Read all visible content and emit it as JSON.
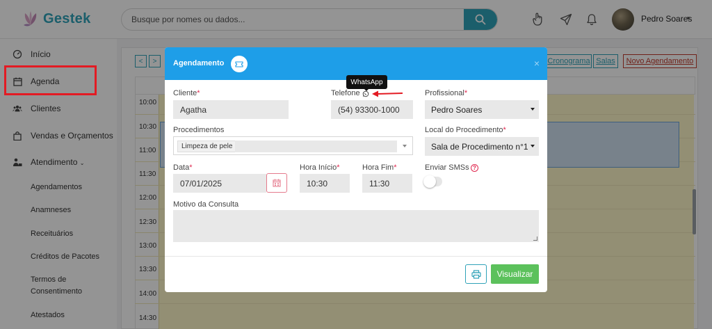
{
  "app": {
    "name": "Gestek",
    "accent": "#2fa2b8"
  },
  "search": {
    "placeholder": "Busque por nomes ou dados..."
  },
  "user": {
    "name": "Pedro Soares"
  },
  "sidebar": {
    "items": [
      {
        "label": "Início",
        "icon": "home-icon"
      },
      {
        "label": "Agenda",
        "icon": "calendar-icon"
      },
      {
        "label": "Clientes",
        "icon": "users-icon"
      },
      {
        "label": "Vendas e Orçamentos",
        "icon": "shopping-bag-icon"
      },
      {
        "label": "Atendimento",
        "icon": "stethoscope-icon",
        "expanded": true
      }
    ],
    "subitems": [
      "Agendamentos",
      "Anamneses",
      "Receituários",
      "Créditos de Pacotes",
      "Termos de Consentimento",
      "Atestados"
    ]
  },
  "calendar": {
    "nav_prev": "<",
    "nav_next": ">",
    "buttons": {
      "cronograma": "Cronograma",
      "salas": "Salas",
      "novo": "Novo Agendamento"
    },
    "times": [
      "10:00",
      "10:30",
      "11:00",
      "11:30",
      "12:00",
      "12:30",
      "13:00",
      "13:30",
      "14:00",
      "14:30"
    ]
  },
  "modal": {
    "title": "Agendamento",
    "tooltip": "WhatsApp",
    "fields": {
      "cliente": {
        "label": "Cliente",
        "value": "Agatha"
      },
      "telefone": {
        "label": "Telefone",
        "value": "(54) 93300-1000"
      },
      "profissional": {
        "label": "Profissional",
        "value": "Pedro Soares"
      },
      "procedimentos": {
        "label": "Procedimentos",
        "tag": "Limpeza de pele"
      },
      "local": {
        "label": "Local do Procedimento",
        "value": "Sala de Procedimento n°1"
      },
      "data": {
        "label": "Data",
        "value": "07/01/2025"
      },
      "hora_inicio": {
        "label": "Hora Início",
        "value": "10:30"
      },
      "hora_fim": {
        "label": "Hora Fim",
        "value": "11:30"
      },
      "enviar_sms": {
        "label": "Enviar SMSs",
        "enabled": false
      },
      "motivo": {
        "label": "Motivo da Consulta",
        "value": ""
      }
    },
    "actions": {
      "visualizar": "Visualizar"
    },
    "colors": {
      "header": "#1e9ee8",
      "primary_button": "#5cc15c",
      "required": "#e0284f"
    }
  },
  "annotation": {
    "color": "#e31b23"
  }
}
